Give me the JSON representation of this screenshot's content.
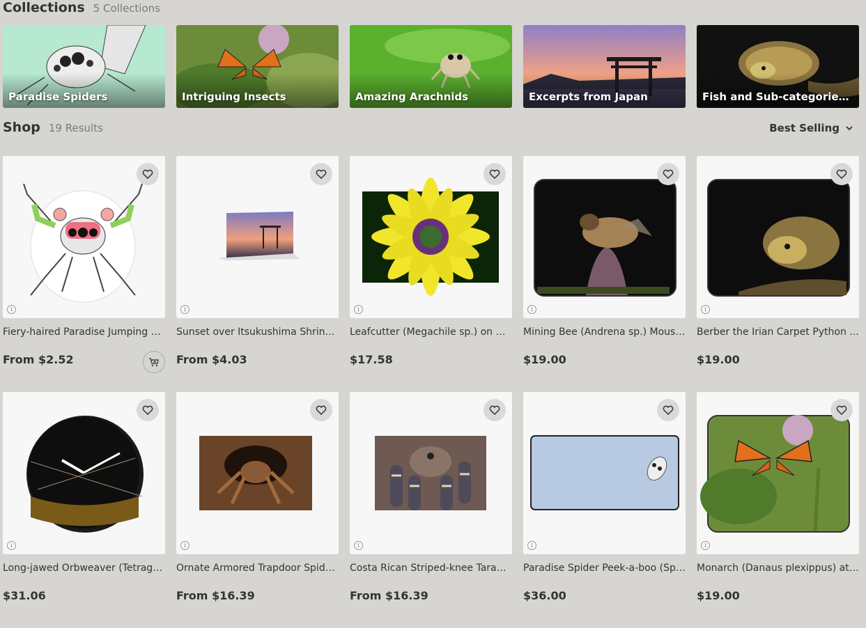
{
  "collections_section": {
    "title": "Collections",
    "count": "5 Collections"
  },
  "collections": [
    {
      "label": "Paradise Spiders"
    },
    {
      "label": "Intriguing Insects"
    },
    {
      "label": "Amazing Arachnids"
    },
    {
      "label": "Excerpts from Japan"
    },
    {
      "label": "Fish and Sub-categories o..."
    }
  ],
  "shop": {
    "title": "Shop",
    "count": "19 Results",
    "sort_label": "Best Selling"
  },
  "products": [
    {
      "title": "Fiery-haired Paradise Jumping S...",
      "price": "From $2.52"
    },
    {
      "title": "Sunset over Itsukushima Shrine ...",
      "price": "From $4.03"
    },
    {
      "title": "Leafcutter (Megachile sp.) on As...",
      "price": "$17.58"
    },
    {
      "title": "Mining Bee (Andrena sp.) Mouse...",
      "price": "$19.00"
    },
    {
      "title": "Berber the Irian Carpet Python ...",
      "price": "$19.00"
    },
    {
      "title": "Long-jawed Orbweaver (Tetragn...",
      "price": "$31.06"
    },
    {
      "title": "Ornate Armored Trapdoor Spider...",
      "price": "From $16.39"
    },
    {
      "title": "Costa Rican Striped-knee Tarant...",
      "price": "From $16.39"
    },
    {
      "title": "Paradise Spider Peek-a-boo (Spi...",
      "price": "$36.00"
    },
    {
      "title": "Monarch (Danaus plexippus) at ...",
      "price": "$19.00"
    }
  ],
  "icons": {
    "heart": "heart-icon",
    "info": "info-icon",
    "cart": "add-to-cart-icon",
    "chevron": "chevron-down-icon"
  }
}
